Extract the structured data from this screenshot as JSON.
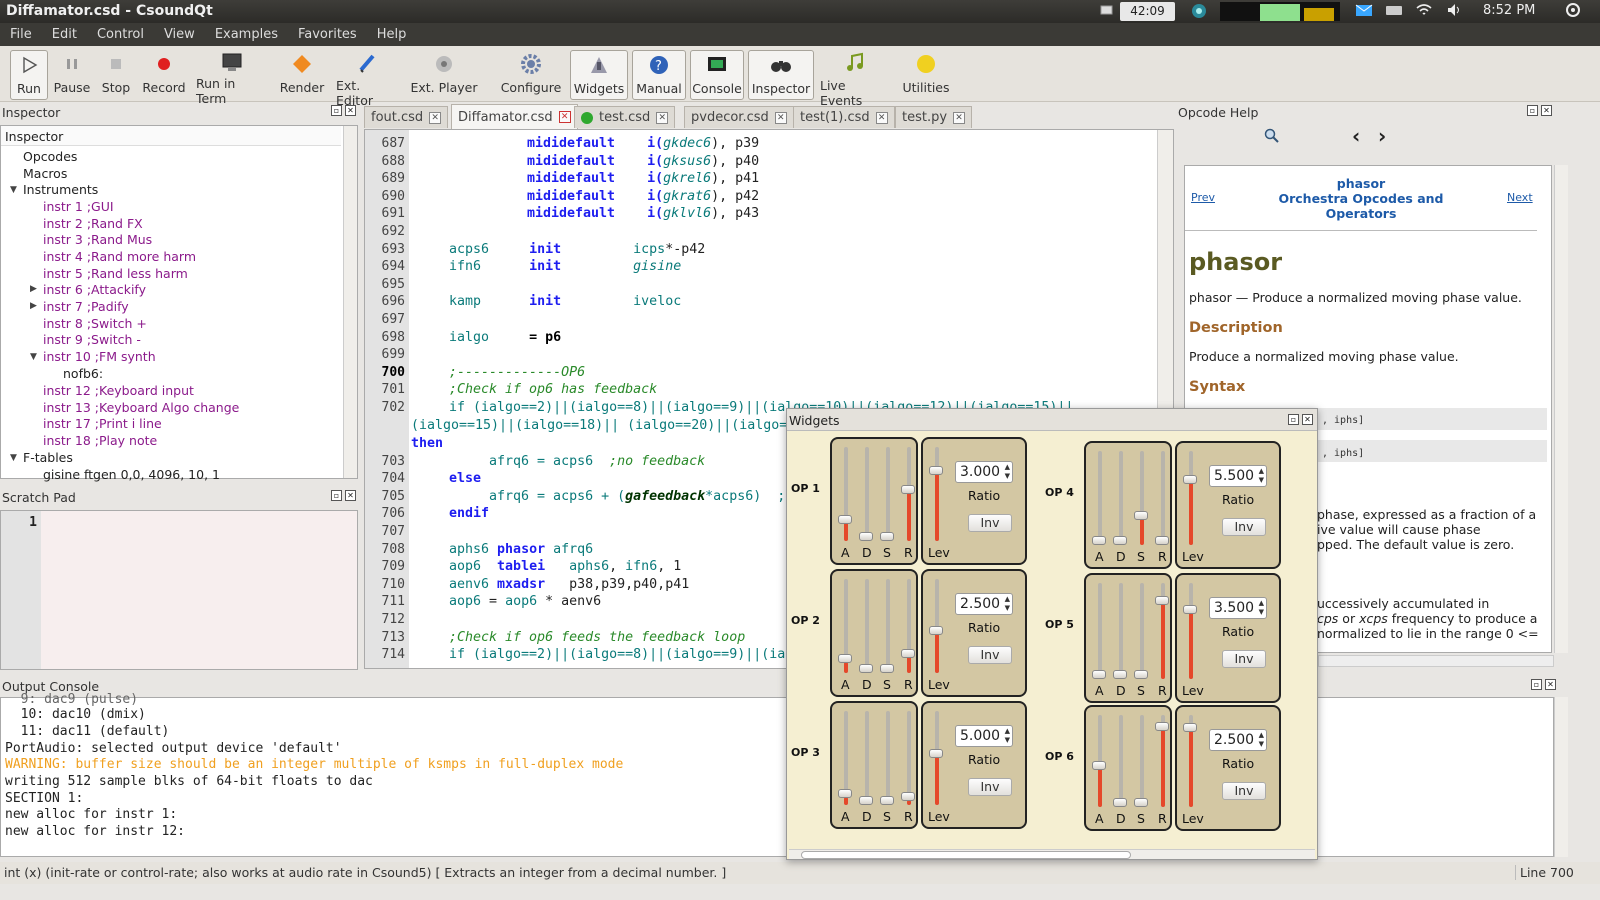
{
  "window_title": "Diffamator.csd - CsoundQt",
  "tray": {
    "battery_time": "42:09",
    "clock": "8:52 PM"
  },
  "menu": [
    "File",
    "Edit",
    "Control",
    "View",
    "Examples",
    "Favorites",
    "Help"
  ],
  "toolbar": {
    "run": "Run",
    "pause": "Pause",
    "stop": "Stop",
    "record": "Record",
    "run_in_term": "Run in Term",
    "render": "Render",
    "ext_editor": "Ext. Editor",
    "ext_player": "Ext. Player",
    "configure": "Configure",
    "widgets": "Widgets",
    "manual": "Manual",
    "console": "Console",
    "inspector": "Inspector",
    "live_events": "Live Events",
    "utilities": "Utilities"
  },
  "inspector": {
    "dock_title": "Inspector",
    "header": "Inspector",
    "items": [
      "Opcodes",
      "Macros",
      "Instruments",
      "instr 1 ;GUI",
      "instr 2 ;Rand FX",
      "instr 3 ;Rand Mus",
      "instr 4 ;Rand more harm",
      "instr 5 ;Rand less harm",
      "instr 6 ;Attackify",
      "instr 7 ;Padify",
      "instr 8 ;Switch +",
      "instr 9 ;Switch -",
      "instr 10 ;FM synth",
      "nofb6:",
      "instr 12 ;Keyboard input",
      "instr 13 ;Keyboard Algo change",
      "instr 17 ;Print i line",
      "instr 18 ;Play note",
      "F-tables",
      "gisine ftgen 0,0, 4096, 10, 1"
    ]
  },
  "scratch": {
    "title": "Scratch Pad",
    "line": "1"
  },
  "tabs": [
    "fout.csd",
    "Diffamator.csd",
    "test.csd",
    "pvdecor.csd",
    "test(1).csd",
    "test.py"
  ],
  "editor": {
    "line_numbers": [
      "687",
      "688",
      "689",
      "690",
      "691",
      "692",
      "693",
      "694",
      "695",
      "696",
      "697",
      "698",
      "699",
      "700",
      "701",
      "702",
      "",
      "",
      "703",
      "704",
      "705",
      "706",
      "707",
      "708",
      "709",
      "710",
      "711",
      "712",
      "713",
      "714"
    ],
    "code": {
      "l687": [
        "mididefault",
        "i(",
        "gkdec6",
        "), p39"
      ],
      "l688": [
        "mididefault",
        "i(",
        "gksus6",
        "), p40"
      ],
      "l689": [
        "mididefault",
        "i(",
        "gkrel6",
        "), p41"
      ],
      "l690": [
        "mididefault",
        "i(",
        "gkrat6",
        "), p42"
      ],
      "l691": [
        "mididefault",
        "i(",
        "gklvl6",
        "), p43"
      ],
      "l693": [
        "acps6",
        "init",
        "icps",
        "*-p42"
      ],
      "l694": [
        "ifn6",
        "init",
        "gisine"
      ],
      "l696": [
        "kamp",
        "init",
        "iveloc"
      ],
      "l698": [
        "ialgo",
        "= p6"
      ],
      "l700": ";-------------OP6",
      "l701": ";Check if op6 has feedback",
      "l702a": "if (ialgo==2)||(ialgo==8)||(ialgo==9)||(ialgo==10)||(ialgo==12)||(ialgo==15)||",
      "l702b": "(ialgo==15)||(ialgo==18)|| (ialgo==20)||(ialgo==",
      "l702c": "then",
      "l703": [
        "afrq6",
        "= acps6",
        "  ;no feedback"
      ],
      "l704": "else",
      "l705": [
        "afrq6",
        "= acps6 + (",
        "gafeedback",
        "*acps6)  ;f"
      ],
      "l706": "endif",
      "l708": [
        "aphs6",
        "phasor",
        "afrq6"
      ],
      "l709": [
        "aop6",
        "tablei",
        "aphs6",
        ", ",
        "ifn6",
        ", 1"
      ],
      "l710": [
        "aenv6",
        "mxadsr",
        "p38,p39,p40,p41"
      ],
      "l711": [
        "aop6",
        "= ",
        "aop6",
        " * aenv6"
      ],
      "l713": ";Check if op6 feeds the feedback loop",
      "l714": "if (ialgo==2)||(ialgo==8)||(ialgo==9)||(ial"
    }
  },
  "opcode_help": {
    "dock_title": "Opcode Help",
    "prev": "Prev",
    "next": "Next",
    "nav_title_1": "phasor",
    "nav_title_2": "Orchestra Opcodes and",
    "nav_title_3": "Operators",
    "heading": "phasor",
    "summary": "phasor — Produce a normalized moving phase value.",
    "desc_heading": "Description",
    "desc": "Produce a normalized moving phase value.",
    "syntax_heading": "Syntax",
    "syn1": ", iphs]",
    "syn2": ", iphs]",
    "t1": "phase, expressed as a fraction of a",
    "t2": "ive value will cause phase",
    "t3": "pped. The default value is zero.",
    "t4": "uccessively accumulated in",
    "t5a": "cps",
    "t5b": " or ",
    "t5c": "xcps",
    "t5d": " frequency to produce a",
    "t6": "normalized to lie in the range 0 <="
  },
  "console": {
    "title": "Output Console",
    "lines": [
      "  9: dac9 (pulse)",
      "  10: dac10 (dmix)",
      "  11: dac11 (default)",
      "PortAudio: selected output device 'default'",
      "WARNING: buffer size should be an integer multiple of ksmps in full-duplex mode",
      "writing 512 sample blks of 64-bit floats to dac",
      "SECTION 1:",
      "new alloc for instr 1:",
      "new alloc for instr 12:"
    ],
    "warning_color": "#f0a020"
  },
  "status": {
    "text": "int (x) (init-rate or control-rate; also works at audio rate in Csound5)   [ Extracts an integer from a decimal number. ]",
    "line": "Line 700"
  },
  "widgets": {
    "title": "Widgets",
    "adsr_labels": [
      "A",
      "D",
      "S",
      "R"
    ],
    "lev_label": "Lev",
    "ratio_label": "Ratio",
    "inv_label": "Inv",
    "ops": [
      {
        "name": "OP 1",
        "ratio": "3.000",
        "adsr": [
          0.2,
          0.0,
          0.0,
          0.55
        ],
        "lev": 0.78
      },
      {
        "name": "OP 2",
        "ratio": "2.500",
        "adsr": [
          0.12,
          0.0,
          0.0,
          0.18
        ],
        "lev": 0.45
      },
      {
        "name": "OP 3",
        "ratio": "5.000",
        "adsr": [
          0.08,
          0.0,
          0.0,
          0.05
        ],
        "lev": 0.55
      },
      {
        "name": "OP 4",
        "ratio": "5.500",
        "adsr": [
          0.0,
          0.0,
          0.3,
          0.0
        ],
        "lev": 0.72
      },
      {
        "name": "OP 5",
        "ratio": "3.500",
        "adsr": [
          0.0,
          0.0,
          0.0,
          0.85
        ],
        "lev": 0.75
      },
      {
        "name": "OP 6",
        "ratio": "2.500",
        "adsr": [
          0.45,
          0.0,
          0.0,
          0.92
        ],
        "lev": 0.9
      }
    ],
    "accent_color": "#e5482a"
  }
}
